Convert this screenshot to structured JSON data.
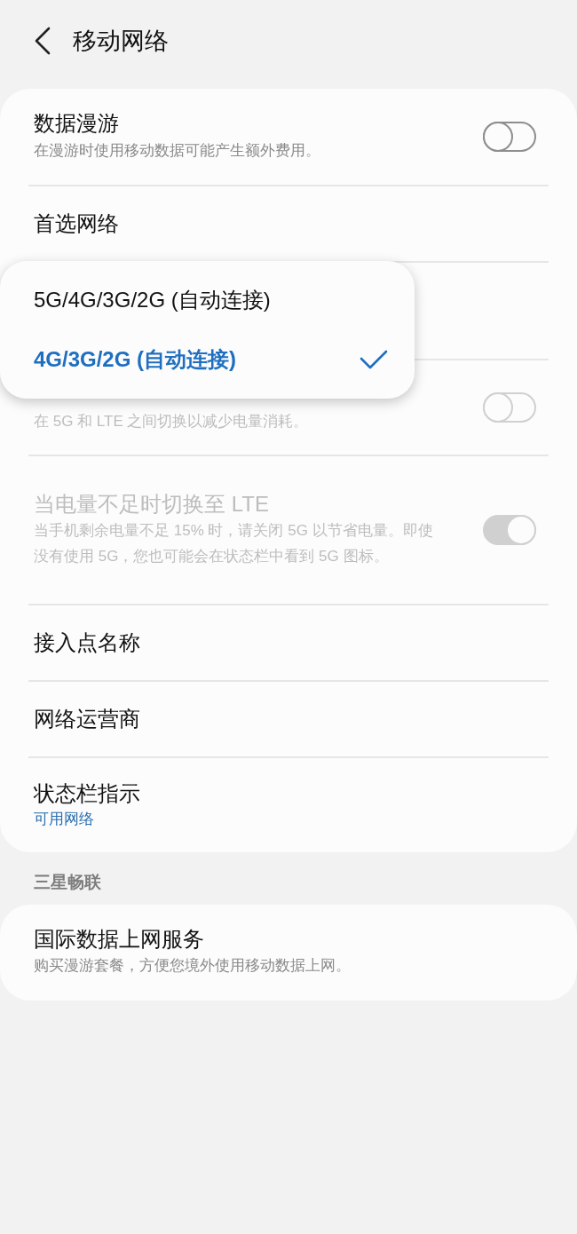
{
  "header": {
    "title": "移动网络"
  },
  "groups": [
    {
      "items": [
        {
          "kind": "switch",
          "title": "数据漫游",
          "subtitle": "在漫游时使用移动数据可能产生额外费用。",
          "on": false,
          "disabled": false
        },
        {
          "kind": "link",
          "title": "首选网络",
          "dropdown": {
            "options": [
              {
                "label": "5G/4G/3G/2G (自动连接)",
                "selected": false
              },
              {
                "label": "4G/3G/2G (自动连接)",
                "selected": true
              }
            ]
          }
        },
        {
          "kind": "switch",
          "subtitle": "在 5G 和 LTE 之间切换以减少电量消耗。",
          "on": false,
          "disabled": true
        },
        {
          "kind": "switch",
          "title": "当电量不足时切换至 LTE",
          "subtitle": "当手机剩余电量不足 15% 时，请关闭 5G 以节省电量。即使没有使用 5G，您也可能会在状态栏中看到 5G 图标。",
          "on": true,
          "disabled": true
        },
        {
          "kind": "link",
          "title": "接入点名称"
        },
        {
          "kind": "link",
          "title": "网络运营商"
        },
        {
          "kind": "link",
          "title": "状态栏指示",
          "value": "可用网络"
        }
      ]
    },
    {
      "header": "三星畅联",
      "items": [
        {
          "kind": "link",
          "title": "国际数据上网服务",
          "subtitle": "购买漫游套餐，方便您境外使用移动数据上网。"
        }
      ]
    }
  ]
}
